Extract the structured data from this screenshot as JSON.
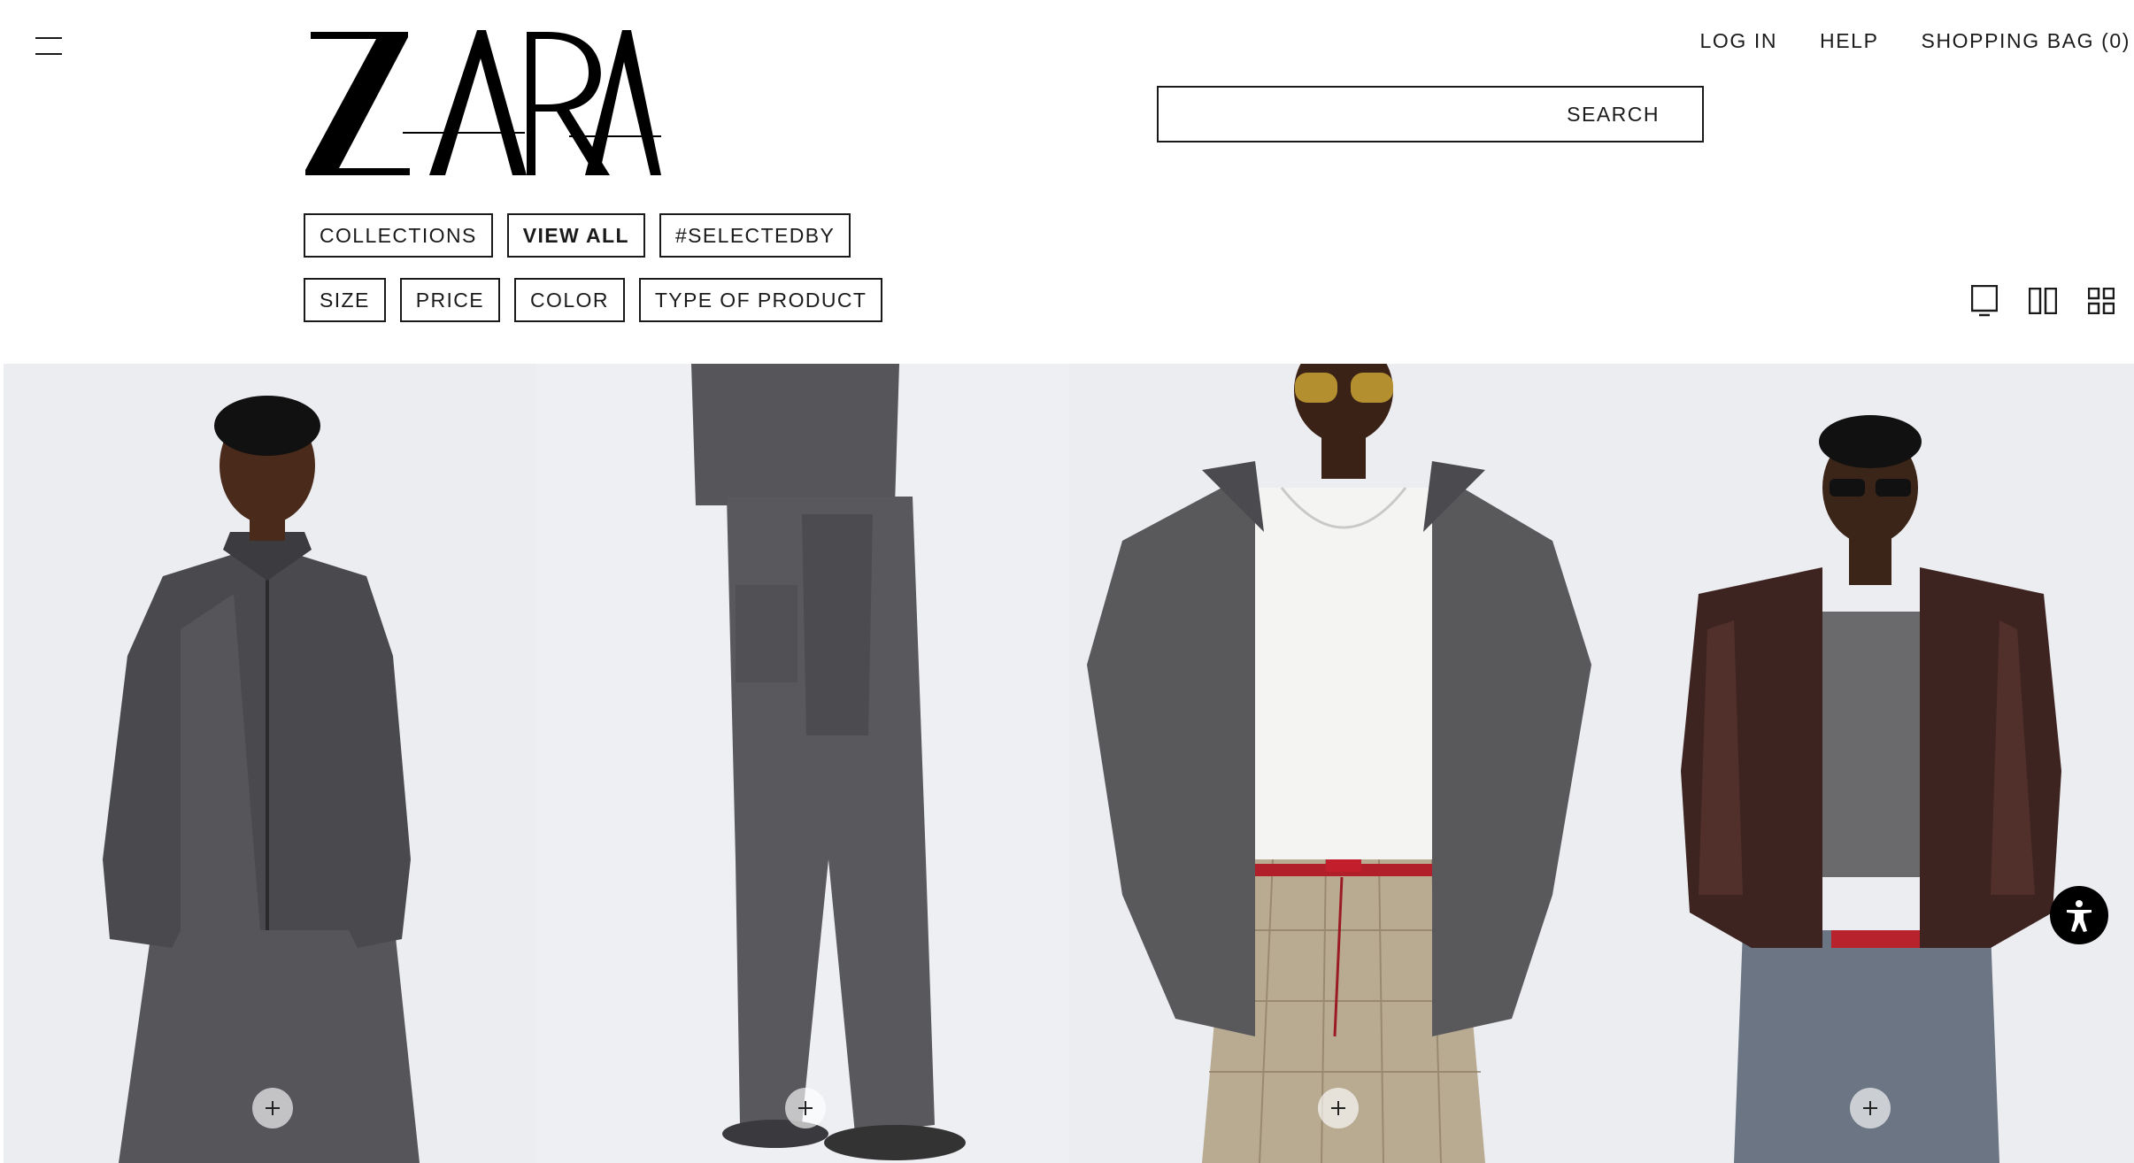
{
  "brand": {
    "logo_text": "ZARA"
  },
  "header": {
    "nav": [
      {
        "label": "LOG IN"
      },
      {
        "label": "HELP"
      },
      {
        "label": "SHOPPING BAG (0)"
      }
    ],
    "search": {
      "label": "SEARCH",
      "value": ""
    }
  },
  "filters": {
    "categories": [
      {
        "label": "COLLECTIONS",
        "active": false
      },
      {
        "label": "VIEW ALL",
        "active": true
      },
      {
        "label": "#SELECTEDBY",
        "active": false
      }
    ],
    "facets": [
      {
        "label": "SIZE"
      },
      {
        "label": "PRICE"
      },
      {
        "label": "COLOR"
      },
      {
        "label": "TYPE OF PRODUCT"
      }
    ],
    "view_modes": [
      "single-column-view-icon",
      "two-column-view-icon",
      "grid-view-icon"
    ]
  },
  "products": [
    {
      "icon": "model-photo-gray-denim-jacket"
    },
    {
      "icon": "model-photo-gray-wide-jeans"
    },
    {
      "icon": "model-photo-gray-hoodie-plaid-skirt"
    },
    {
      "icon": "model-photo-brown-leather-jacket"
    }
  ],
  "colors": {
    "text": "#1a1a1a",
    "background": "#ffffff",
    "photo_bg": "#ecedf1",
    "accessibility_button": "#000000"
  }
}
